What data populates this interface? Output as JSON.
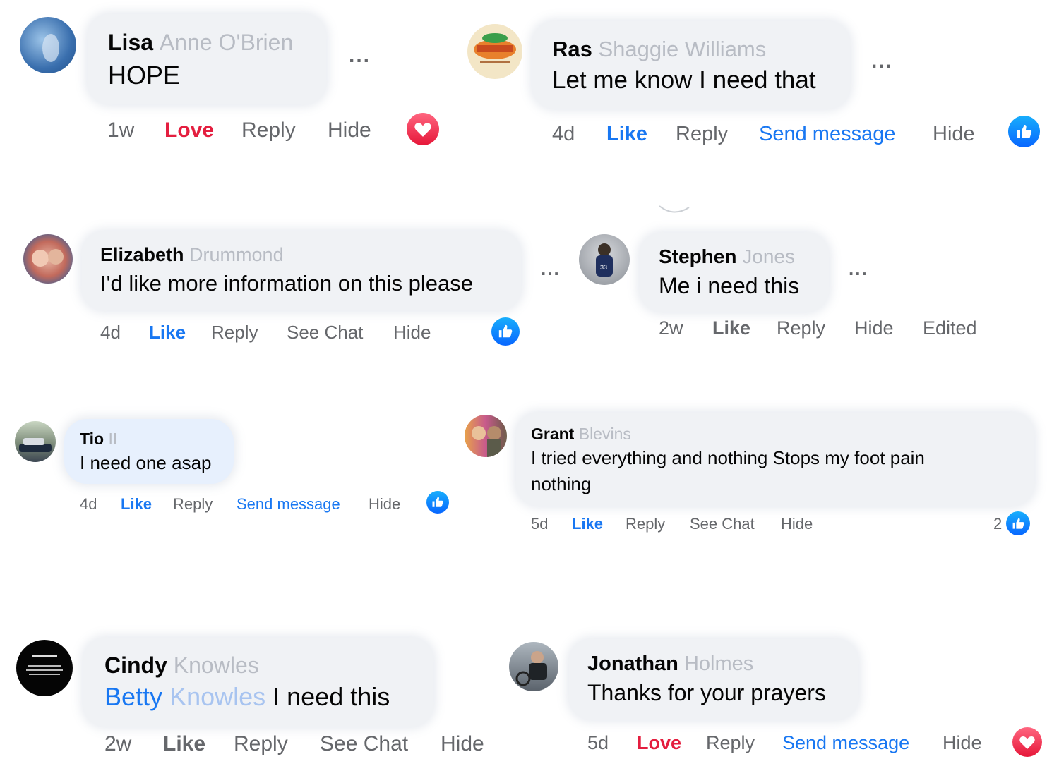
{
  "comments": [
    {
      "first": "Lisa",
      "rest": "Anne O'Brien",
      "text": "HOPE",
      "time": "1w",
      "reaction_label": "Love",
      "reply": "Reply",
      "hide": "Hide",
      "more": "..."
    },
    {
      "first": "Ras",
      "rest": "Shaggie Williams",
      "text": "Let me know I need that",
      "time": "4d",
      "reaction_label": "Like",
      "reply": "Reply",
      "send_message": "Send message",
      "hide": "Hide",
      "more": "..."
    },
    {
      "first": "Elizabeth",
      "rest": "Drummond",
      "text": "I'd like more information on this please",
      "time": "4d",
      "reaction_label": "Like",
      "reply": "Reply",
      "see_chat": "See Chat",
      "hide": "Hide",
      "more": "..."
    },
    {
      "first": "Stephen",
      "rest": "Jones",
      "text": "Me i need this",
      "time": "2w",
      "reaction_label": "Like",
      "reply": "Reply",
      "hide": "Hide",
      "edited": "Edited",
      "more": "..."
    },
    {
      "first": "Tio",
      "rest": "II",
      "text": "I need one asap",
      "time": "4d",
      "reaction_label": "Like",
      "reply": "Reply",
      "send_message": "Send message",
      "hide": "Hide"
    },
    {
      "first": "Grant",
      "rest": "Blevins",
      "text_line1": "I tried everything and nothing Stops my foot pain",
      "text_line2": "nothing",
      "time": "5d",
      "reaction_label": "Like",
      "reply": "Reply",
      "see_chat": "See Chat",
      "hide": "Hide",
      "reaction_count": "2"
    },
    {
      "first": "Cindy",
      "rest": "Knowles",
      "mention_first": "Betty",
      "mention_rest": "Knowles",
      "text": "I need this",
      "time": "2w",
      "reaction_label": "Like",
      "reply": "Reply",
      "see_chat": "See Chat",
      "hide": "Hide"
    },
    {
      "first": "Jonathan",
      "rest": "Holmes",
      "text": "Thanks for your prayers",
      "time": "5d",
      "reaction_label": "Love",
      "reply": "Reply",
      "send_message": "Send message",
      "hide": "Hide"
    }
  ],
  "colors": {
    "like": "#1877f2",
    "love": "#e41e3f",
    "muted": "#65676b",
    "bubble": "#f0f2f5"
  },
  "icons": {
    "like_reaction": "thumbs-up-icon",
    "love_reaction": "heart-icon"
  }
}
